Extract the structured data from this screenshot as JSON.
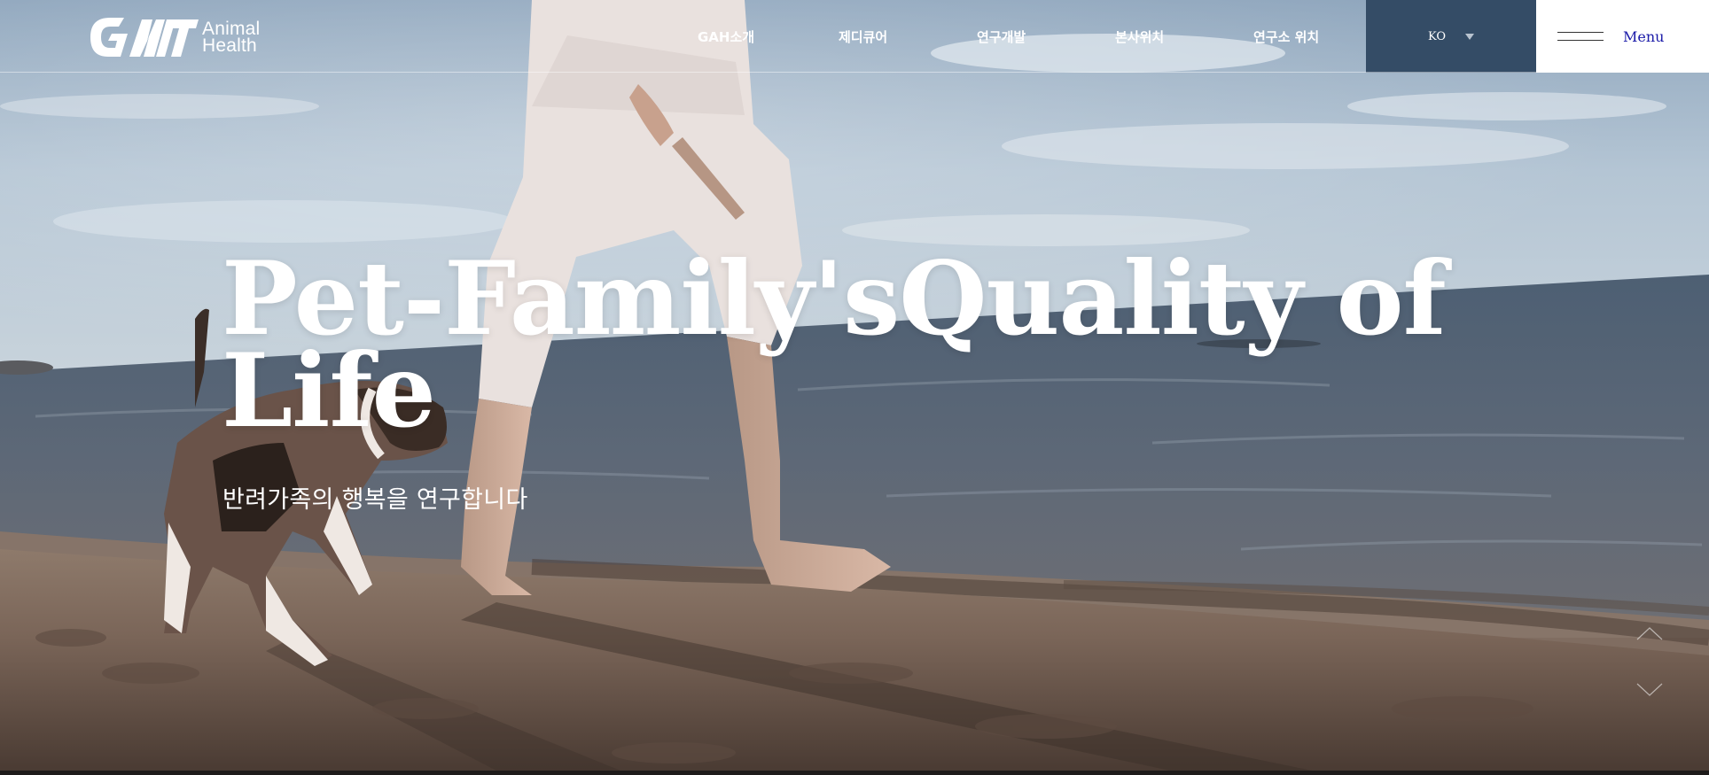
{
  "brand": {
    "logo_mark_text": "GAIT",
    "logo_line1": "Animal",
    "logo_line2": "Health"
  },
  "nav": {
    "items": [
      {
        "label": "GAH소개"
      },
      {
        "label": "제디큐어"
      },
      {
        "label": "연구개발"
      },
      {
        "label": "본사위치"
      },
      {
        "label": "연구소 위치"
      }
    ]
  },
  "language": {
    "selected": "KO",
    "icon": "caret-down-icon"
  },
  "menu": {
    "label": "Menu",
    "icon": "hamburger-icon"
  },
  "hero": {
    "headline_line1": "Pet-Family'sQuality of",
    "headline_line2": "Life",
    "subline": "반려가족의 행복을 연구합니다"
  },
  "slider": {
    "prev_icon": "chevron-up-icon",
    "next_icon": "chevron-down-icon"
  },
  "colors": {
    "language_bg": "#344c66",
    "menu_bg": "#ffffff",
    "menu_text": "#1a1aa8",
    "text": "#ffffff"
  }
}
